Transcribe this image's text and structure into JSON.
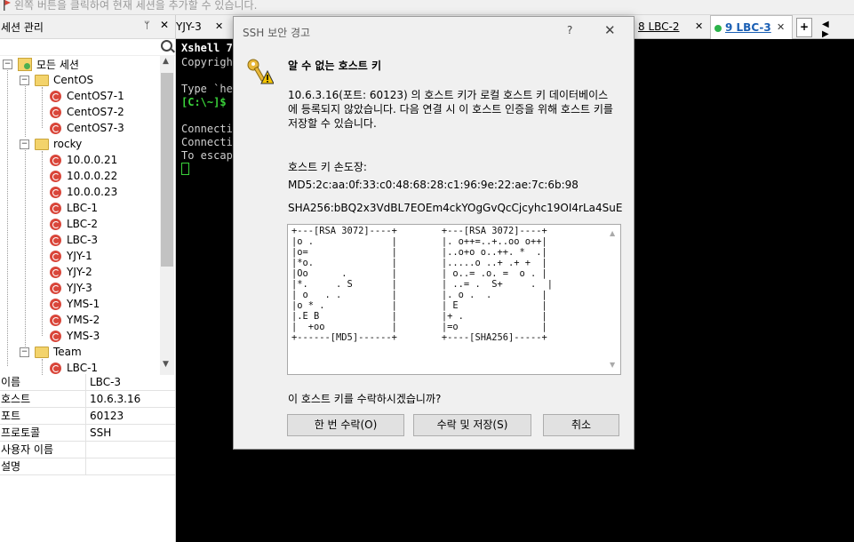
{
  "topbar": {
    "hint": "왼쪽 버튼을 클릭하여 현재 세션을 추가할 수 있습니다."
  },
  "sessions_panel": {
    "title": "세션 관리",
    "pin": "ᛘ",
    "close": "✕",
    "tree": {
      "root": "모든 세션",
      "groups": [
        {
          "name": "CentOS",
          "items": [
            "CentOS7-1",
            "CentOS7-2",
            "CentOS7-3"
          ]
        },
        {
          "name": "rocky",
          "items": [
            "10.0.0.21",
            "10.0.0.22",
            "10.0.0.23",
            "LBC-1",
            "LBC-2",
            "LBC-3",
            "YJY-1",
            "YJY-2",
            "YJY-3",
            "YMS-1",
            "YMS-2",
            "YMS-3"
          ]
        },
        {
          "name": "Team",
          "items": [
            "LBC-1"
          ]
        }
      ]
    },
    "properties": [
      {
        "key": "이름",
        "value": "LBC-3"
      },
      {
        "key": "호스트",
        "value": "10.6.3.16"
      },
      {
        "key": "포트",
        "value": "60123"
      },
      {
        "key": "프로토콜",
        "value": "SSH"
      },
      {
        "key": "사용자 이름",
        "value": ""
      },
      {
        "key": "설명",
        "value": ""
      }
    ]
  },
  "tabs": [
    {
      "label": "YJY-3",
      "close": "✕",
      "active": false
    },
    {
      "label": "8 LBC-2",
      "close": "✕",
      "active": false
    },
    {
      "label": "9 LBC-3",
      "close": "✕",
      "active": true
    }
  ],
  "tab_add": "+",
  "tab_nav": "◀ ▶",
  "terminal": {
    "lines": [
      "Xshell 7",
      "Copyright",
      "",
      "Type `he",
      "[C:\\~]$",
      "",
      "Connectin",
      "Connectio",
      "To escape"
    ]
  },
  "dialog": {
    "title": "SSH 보안 경고",
    "help": "?",
    "close": "✕",
    "heading": "알 수 없는 호스트 키",
    "description": "10.6.3.16(포트: 60123) 의 호스트 키가 로컬 호스트 키 데이터베이스에 등록되지 않았습니다. 다음 연결 시 이 호스트 인증을 위해 호스트 키를 저장할 수 있습니다.",
    "fingerprint_label": "호스트 키 손도장:",
    "md5": "MD5:2c:aa:0f:33:c0:48:68:28:c1:96:9e:22:ae:7c:6b:98",
    "sha256": "SHA256:bBQ2x3VdBL7EOEm4ckYOgGvQcCjcyhc19OI4rLa4SuE",
    "randomart": "+---[RSA 3072]----+        +---[RSA 3072]----+\n|o .              |        |. o++=..+..oo o++|\n|o=               |        |..o+o o..++. *  .|\n|*o.              |        |.....o ..+ .+ +  |\n|Oo      .        |        | o..= .o. =  o . |\n|*.     . S       |        | ..= .  S+     .  |\n| o   . .         |        |. o .  .         |\n|o * .            |        | E               |\n|.E B             |        |+ .              |\n|  +oo            |        |=o               |\n+------[MD5]------+        +----[SHA256]-----+",
    "question": "이 호스트 키를 수락하시겠습니까?",
    "buttons": {
      "accept_once": "한 번 수락(O)",
      "accept_save": "수락 및 저장(S)",
      "cancel": "취소"
    }
  },
  "colors": {
    "terminal_bg": "#000000",
    "prompt_green": "#3ad23a",
    "session_red": "#d9463a",
    "tab_dot_green": "#2bb34a"
  }
}
